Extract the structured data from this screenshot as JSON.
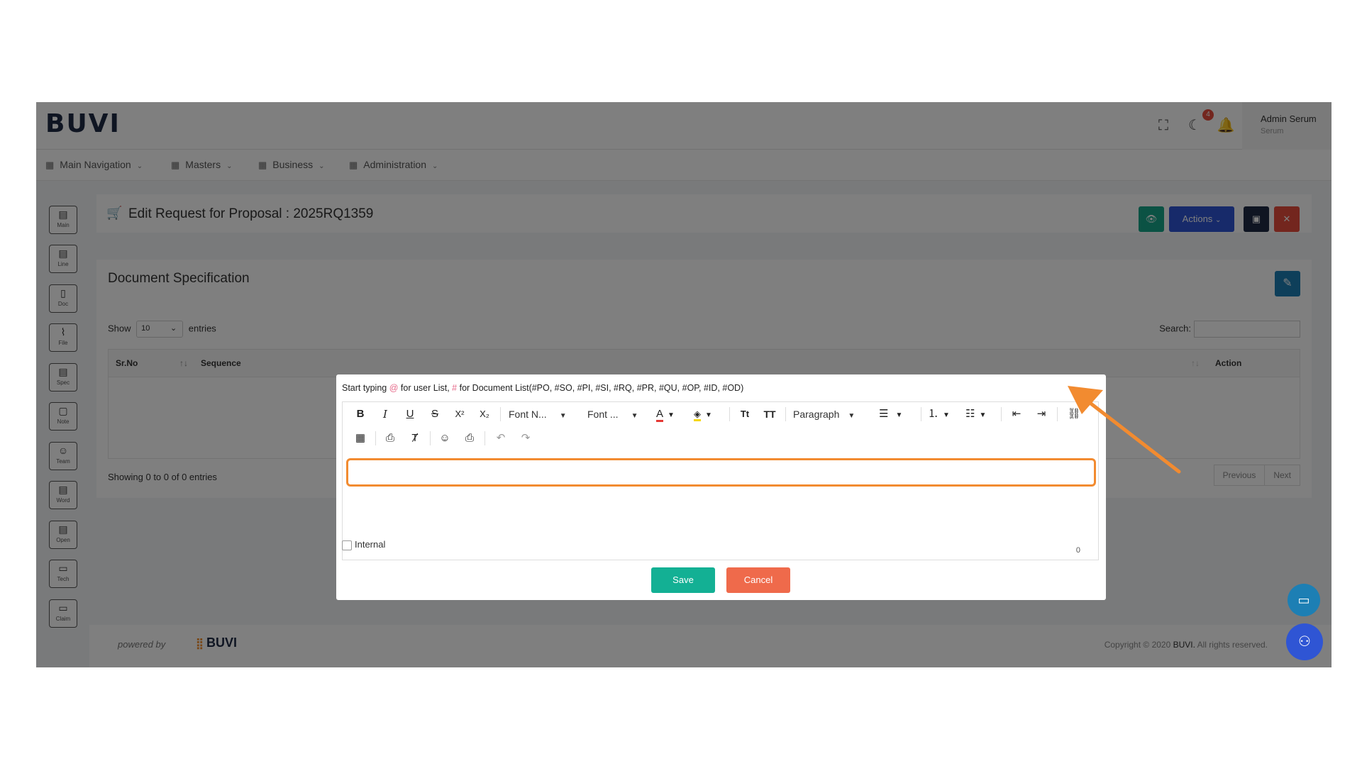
{
  "app": {
    "logo": "BUVI",
    "user_name": "Admin Serum",
    "user_sub": "Serum",
    "notification_count": "4"
  },
  "nav": {
    "items": [
      {
        "label": "Main Navigation"
      },
      {
        "label": "Masters"
      },
      {
        "label": "Business"
      },
      {
        "label": "Administration"
      }
    ]
  },
  "sidebar": {
    "items": [
      {
        "label": "Main",
        "icon": "document-icon"
      },
      {
        "label": "Line",
        "icon": "document-icon"
      },
      {
        "label": "Doc",
        "icon": "file-icon"
      },
      {
        "label": "File",
        "icon": "paperclip-icon"
      },
      {
        "label": "Spec",
        "icon": "document-icon"
      },
      {
        "label": "Note",
        "icon": "note-icon"
      },
      {
        "label": "Team",
        "icon": "team-icon"
      },
      {
        "label": "Word",
        "icon": "document-icon"
      },
      {
        "label": "Open",
        "icon": "document-icon"
      },
      {
        "label": "Tech",
        "icon": "chat-icon"
      },
      {
        "label": "Claim",
        "icon": "chat-icon"
      }
    ]
  },
  "header": {
    "title": "Edit Request for Proposal : 2025RQ1359",
    "actions_label": "Actions",
    "colors": {
      "view": "#17a589",
      "actions": "#2f55d4",
      "save": "#1f2a44",
      "close": "#e74c3c"
    }
  },
  "spec": {
    "title": "Document Specification",
    "show_label": "Show",
    "show_value": "10",
    "entries_label": "entries",
    "search_label": "Search:",
    "columns": [
      "Sr.No",
      "Sequence",
      "Action"
    ],
    "showing_text": "Showing 0 to 0 of 0 entries",
    "prev_label": "Previous",
    "next_label": "Next"
  },
  "footer": {
    "powered_by": "powered by",
    "logo": "BUVI",
    "copyright_pre": "Copyright © 2020",
    "copyright_brand": "BUVI.",
    "copyright_post": "All rights reserved."
  },
  "modal": {
    "hint_pre": "Start typing",
    "hint_at": "@",
    "hint_mid": "for user List,",
    "hint_hash": "#",
    "hint_post": "for Document List(#PO, #SO, #PI, #SI, #RQ, #PR, #QU, #OP, #ID, #OD)",
    "toolbar": {
      "font_name": "Font N...",
      "font_size": "Font ...",
      "block_format": "Paragraph"
    },
    "char_count": "0",
    "internal_label": "Internal",
    "save_label": "Save",
    "cancel_label": "Cancel",
    "colors": {
      "save": "#13b094",
      "cancel": "#ef6a4b",
      "highlight": "#f28b30"
    }
  }
}
